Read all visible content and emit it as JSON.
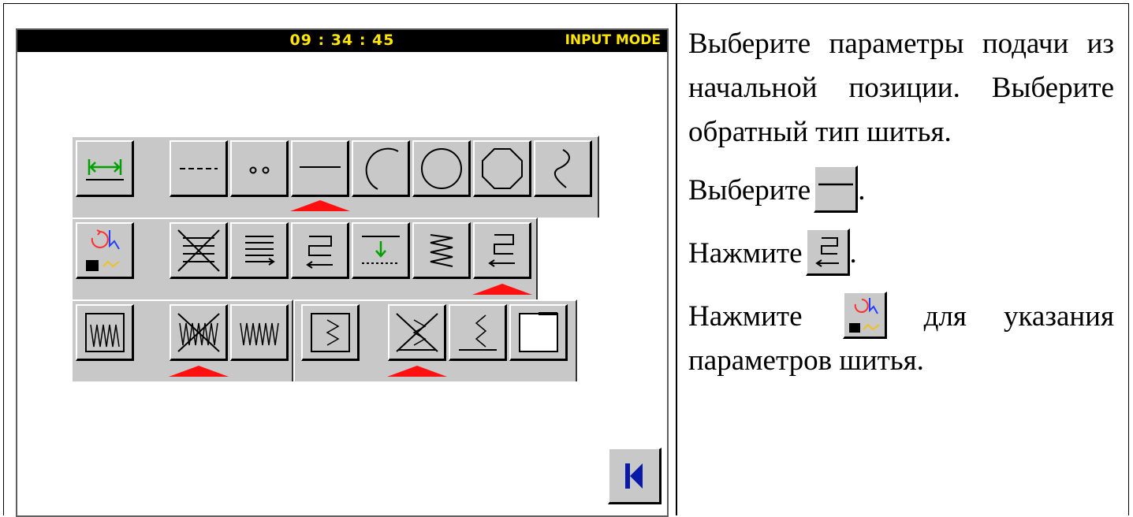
{
  "screen": {
    "clock": "09 : 34 : 45",
    "mode": "INPUT MODE"
  },
  "rows": {
    "row1": [
      "feed-icon",
      "dashed-line-icon",
      "dots-line-icon",
      "straight-line-icon",
      "arc-icon",
      "circle-icon",
      "polygon-icon",
      "curve-icon"
    ],
    "row2": [
      "sewing-params-icon",
      "no-reverse-icon",
      "reverse-multi-icon",
      "reverse-return-icon",
      "reverse-down-icon",
      "reverse-zigzag-icon",
      "reverse-back-icon"
    ],
    "row3": [
      "zigzag-frame-icon",
      "no-zigzag-icon",
      "zigzag-icon",
      "step-zigzag-icon",
      "no-step-icon",
      "step-line-icon",
      "blank-square-icon"
    ]
  },
  "colors": {
    "selected_marker": "#ff1010",
    "clock_text": "#ffe600",
    "button_face": "#c8c8c8"
  },
  "instructions": {
    "p1": "Выберите параметры подачи из начальной позиции. Выберите обратный тип шитья.",
    "p2_text": "Выберите",
    "p2_end": ".",
    "p3_text": "Нажмите",
    "p3_end": ".",
    "p4_text": "Нажмите",
    "p4_rest": "для указания параметров шитья."
  }
}
